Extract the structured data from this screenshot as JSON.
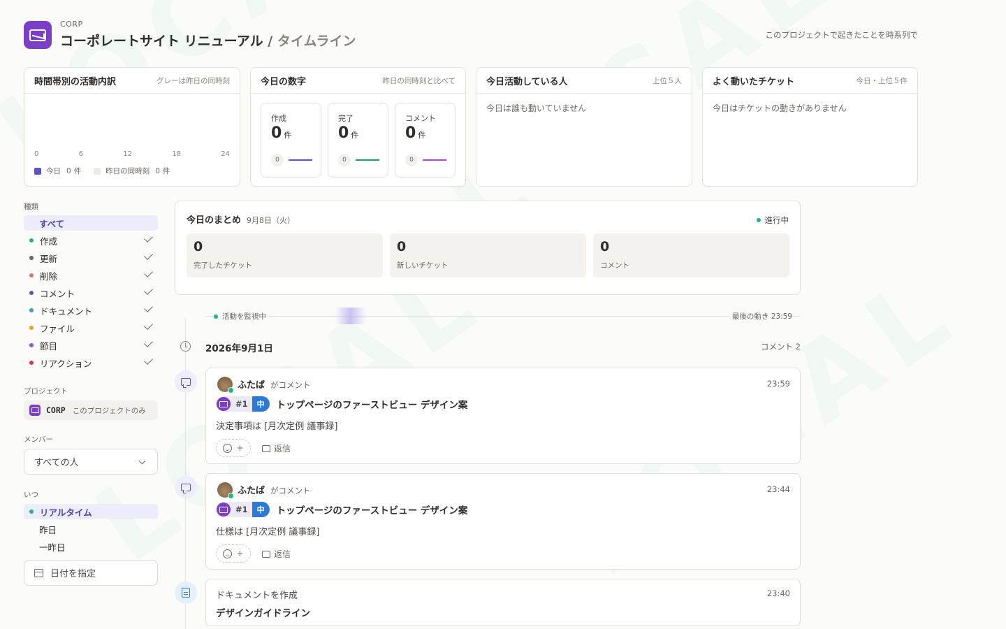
{
  "header": {
    "org": "CORP",
    "project": "コーポレートサイト リニューアル",
    "separator": "/",
    "page": "タイムライン",
    "description": "このプロジェクトで起きたことを時系列で",
    "logo_color": "#7a3ec8"
  },
  "watermark": "LOCAL",
  "hourly": {
    "title": "時間帯別の活動内訳",
    "note": "グレーは昨日の同時刻",
    "ticks": [
      "0",
      "6",
      "12",
      "18",
      "24"
    ],
    "legend_today": "今日",
    "today_count": "0",
    "legend_yesterday": "昨日の同時刻",
    "yesterday_count": "0",
    "unit": "件",
    "today_color": "#5a55c8"
  },
  "numbers": {
    "title": "今日の数字",
    "note": "昨日の同時刻と比べて",
    "unit": "件",
    "items": [
      {
        "label": "作成",
        "value": "0",
        "prev": "0",
        "color": "#5a55c8"
      },
      {
        "label": "完了",
        "value": "0",
        "prev": "0",
        "color": "#1a9a7a"
      },
      {
        "label": "コメント",
        "value": "0",
        "prev": "0",
        "color": "#a04ad8"
      }
    ]
  },
  "active_people": {
    "title": "今日活動している人",
    "note": "上位５人",
    "empty": "今日は誰も動いていません"
  },
  "active_tickets": {
    "title": "よく動いたチケット",
    "note": "今日・上位５件",
    "empty": "今日はチケットの動きがありません"
  },
  "sidebar": {
    "type_heading": "種類",
    "types": [
      {
        "label": "すべて",
        "color": "",
        "checked": false,
        "selected": true
      },
      {
        "label": "作成",
        "color": "#1fb87a",
        "checked": true
      },
      {
        "label": "更新",
        "color": "#6b6660",
        "checked": true
      },
      {
        "label": "削除",
        "color": "#e0706a",
        "checked": true
      },
      {
        "label": "コメント",
        "color": "#5a55c8",
        "checked": true
      },
      {
        "label": "ドキュメント",
        "color": "#2ca0d8",
        "checked": true
      },
      {
        "label": "ファイル",
        "color": "#f0a020",
        "checked": true
      },
      {
        "label": "節目",
        "color": "#a04ad8",
        "checked": true
      },
      {
        "label": "リアクション",
        "color": "#e0304a",
        "checked": true
      }
    ],
    "project_heading": "プロジェクト",
    "project_code": "CORP",
    "project_scope": "このプロジェクトのみ",
    "member_heading": "メンバー",
    "member_select": "すべての人",
    "when_heading": "いつ",
    "when": [
      {
        "label": "リアルタイム",
        "selected": true
      },
      {
        "label": "昨日",
        "selected": false
      },
      {
        "label": "一昨日",
        "selected": false
      }
    ],
    "date_button": "日付を指定"
  },
  "summary": {
    "title": "今日のまとめ",
    "date": "9月8日（火）",
    "status": "進行中",
    "boxes": [
      {
        "value": "0",
        "label": "完了したチケット"
      },
      {
        "value": "0",
        "label": "新しいチケット"
      },
      {
        "value": "0",
        "label": "コメント"
      }
    ]
  },
  "monitor": {
    "left": "活動を監視中",
    "right": "最後の動き 23:59"
  },
  "timeline": {
    "date": "2026年9月1日",
    "count": "コメント 2",
    "events": [
      {
        "user": "ふたば",
        "action": "がコメント",
        "time": "23:59",
        "ticket_no": "#1",
        "priority": "中",
        "ticket_title": "トップページのファーストビュー デザイン案",
        "body": "決定事項は [月次定例 議事録]",
        "reaction_add": "+",
        "reply": "返信"
      },
      {
        "user": "ふたば",
        "action": "がコメント",
        "time": "23:44",
        "ticket_no": "#1",
        "priority": "中",
        "ticket_title": "トップページのファーストビュー デザイン案",
        "body": "仕様は [月次定例 議事録]",
        "reaction_add": "+",
        "reply": "返信"
      }
    ],
    "doc_event": {
      "action": "ドキュメントを作成",
      "time": "23:40",
      "title": "デザインガイドライン"
    }
  }
}
